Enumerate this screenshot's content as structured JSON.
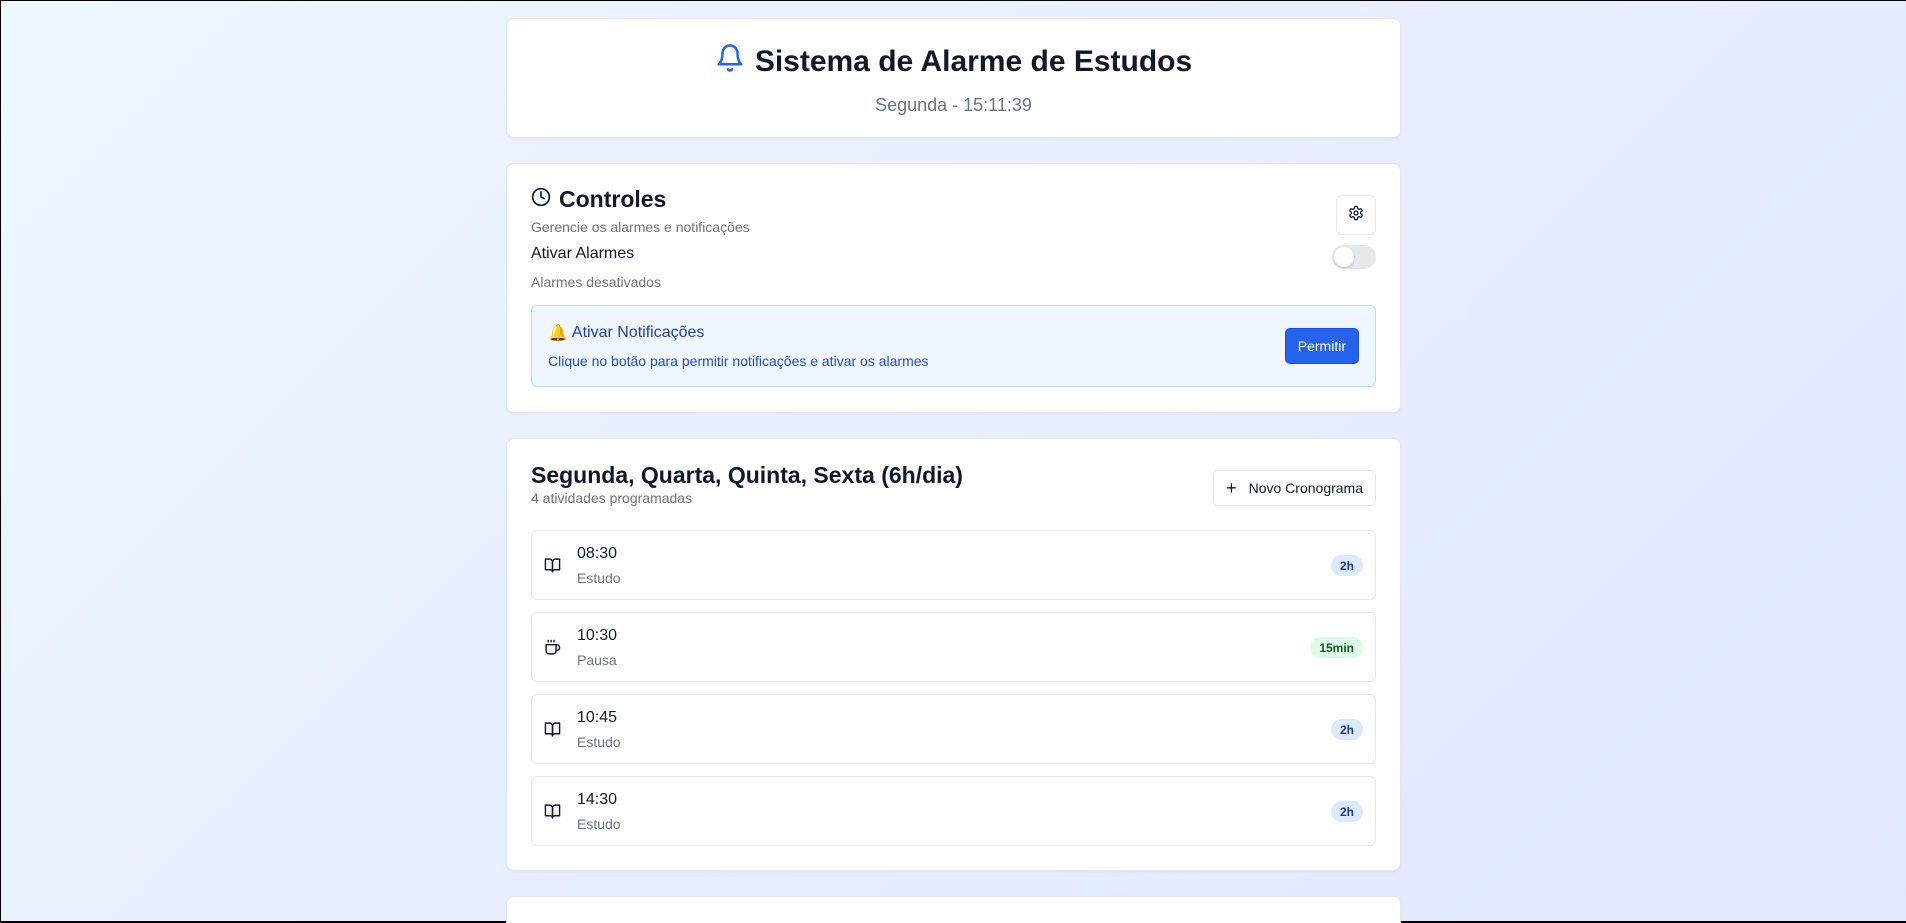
{
  "header": {
    "title": "Sistema de Alarme de Estudos",
    "subtitle": "Segunda - 15:11:39",
    "icon": "bell-icon",
    "accent": "#2563eb"
  },
  "controls": {
    "title": "Controles",
    "description": "Gerencie os alarmes e notificações",
    "settings_icon": "gear-icon",
    "toggle_label": "Ativar Alarmes",
    "toggle_status": "Alarmes desativados",
    "toggle_on": false,
    "notification": {
      "title": "Ativar Notificações",
      "description": "Clique no botão para permitir notificações e ativar os alarmes",
      "button_label": "Permitir"
    }
  },
  "schedule": {
    "title": "Segunda, Quarta, Quinta, Sexta (6h/dia)",
    "subtitle": "4 atividades programadas",
    "new_button_label": "Novo Cronograma",
    "activities": [
      {
        "time": "08:30",
        "type": "Estudo",
        "duration": "2h",
        "kind": "study"
      },
      {
        "time": "10:30",
        "type": "Pausa",
        "duration": "15min",
        "kind": "break"
      },
      {
        "time": "10:45",
        "type": "Estudo",
        "duration": "2h",
        "kind": "study"
      },
      {
        "time": "14:30",
        "type": "Estudo",
        "duration": "2h",
        "kind": "study"
      }
    ]
  }
}
